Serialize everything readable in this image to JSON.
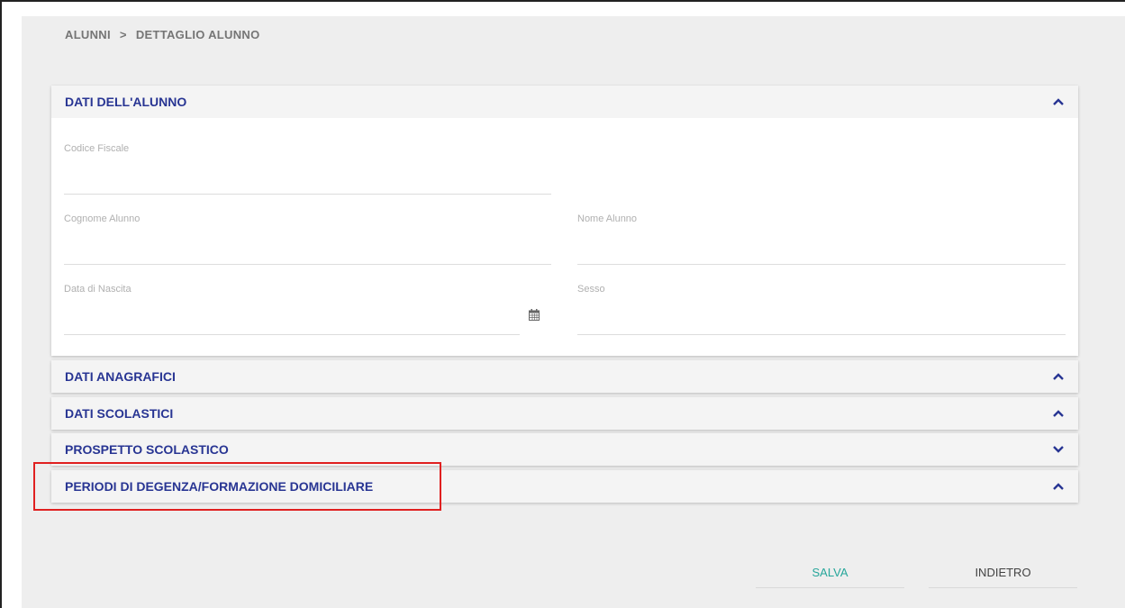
{
  "breadcrumb": {
    "root": "ALUNNI",
    "separator": ">",
    "current": "DETTAGLIO ALUNNO"
  },
  "sections": {
    "dati_alunno": {
      "title": "DATI DELL'ALUNNO",
      "expanded": true,
      "fields": {
        "codice_fiscale": {
          "label": "Codice Fiscale",
          "value": ""
        },
        "cognome": {
          "label": "Cognome Alunno",
          "value": ""
        },
        "nome": {
          "label": "Nome Alunno",
          "value": ""
        },
        "data_nascita": {
          "label": "Data di Nascita",
          "value": ""
        },
        "sesso": {
          "label": "Sesso",
          "value": ""
        }
      }
    },
    "dati_anagrafici": {
      "title": "DATI ANAGRAFICI",
      "chevron": "chevron-up-icon"
    },
    "dati_scolastici": {
      "title": "DATI SCOLASTICI",
      "chevron": "chevron-up-icon"
    },
    "prospetto_scolastico": {
      "title": "PROSPETTO SCOLASTICO",
      "chevron": "chevron-down-icon"
    },
    "periodi_degenza": {
      "title": "PERIODI DI DEGENZA/FORMAZIONE DOMICILIARE",
      "chevron": "chevron-up-icon",
      "highlighted": true
    }
  },
  "buttons": {
    "save": "SALVA",
    "back": "INDIETRO"
  },
  "colors": {
    "section_title": "#283593",
    "save_button": "#26a69a",
    "highlight_border": "#e02020",
    "background": "#eeeeee"
  }
}
